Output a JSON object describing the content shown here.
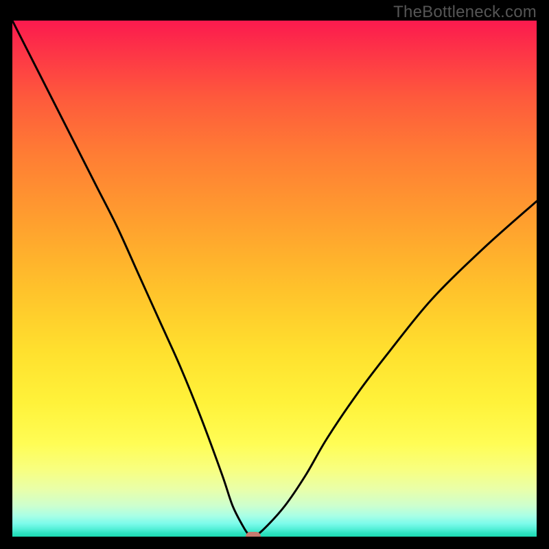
{
  "watermark": "TheBottleneck.com",
  "chart_data": {
    "type": "line",
    "title": "",
    "xlabel": "",
    "ylabel": "",
    "xlim": [
      0,
      100
    ],
    "ylim": [
      0,
      100
    ],
    "grid": false,
    "legend": false,
    "series": [
      {
        "name": "bottleneck-curve",
        "x": [
          0,
          4,
          8,
          12,
          16,
          20,
          24,
          28,
          32,
          36,
          40,
          42,
          44,
          45,
          46,
          48,
          52,
          56,
          60,
          66,
          72,
          80,
          90,
          100
        ],
        "y": [
          100,
          92,
          84,
          76,
          68,
          60,
          51,
          42,
          33,
          23,
          12,
          6,
          2,
          0.5,
          0,
          1.5,
          6,
          12,
          19,
          28,
          36,
          46,
          56,
          65
        ]
      }
    ],
    "marker": {
      "x": 46,
      "y": 0,
      "color": "#c77a6f"
    },
    "background_gradient": {
      "top": "#fc1a4e",
      "mid": "#ffe02e",
      "bottom": "#1cd9b2"
    }
  }
}
